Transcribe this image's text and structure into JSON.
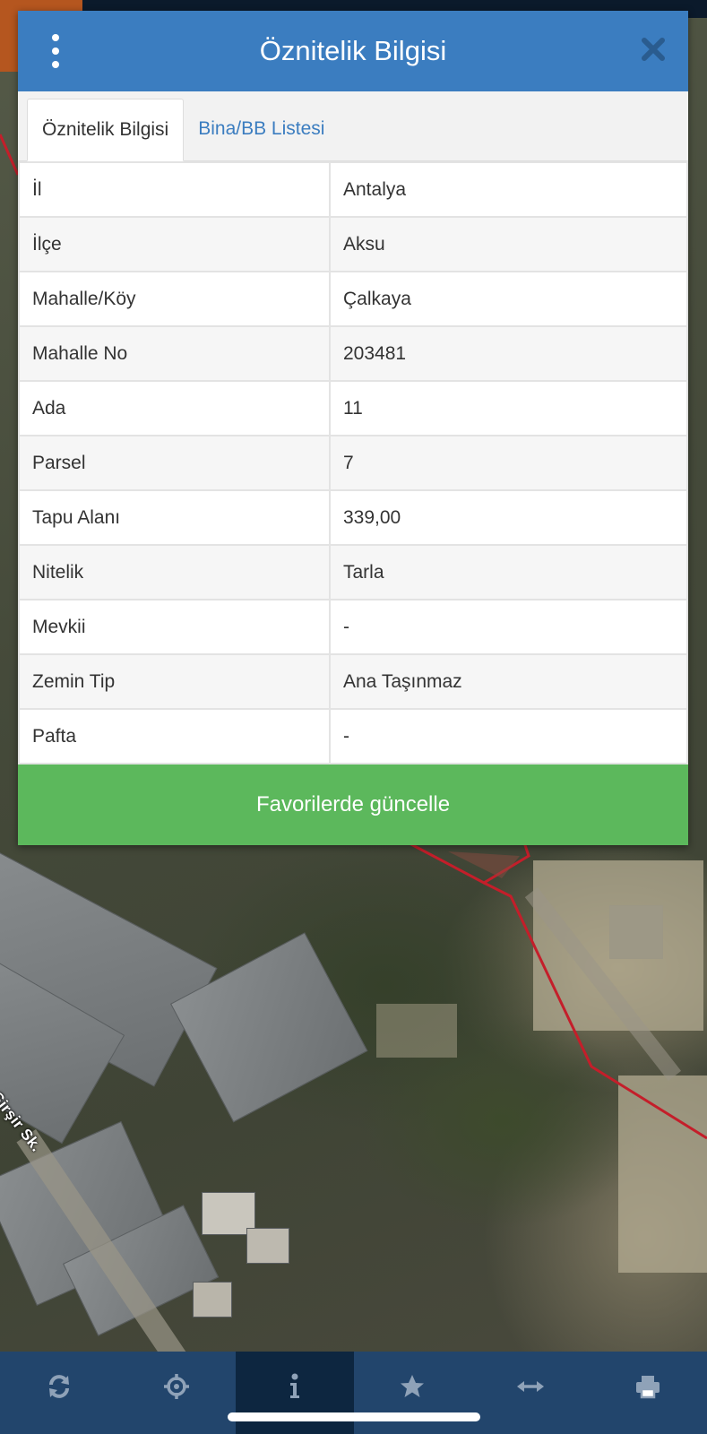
{
  "panel": {
    "title": "Öznitelik Bilgisi",
    "tabs": [
      {
        "label": "Öznitelik Bilgisi",
        "active": true
      },
      {
        "label": "Bina/BB Listesi",
        "active": false
      }
    ],
    "rows": [
      {
        "key": "İl",
        "value": "Antalya"
      },
      {
        "key": "İlçe",
        "value": "Aksu"
      },
      {
        "key": "Mahalle/Köy",
        "value": "Çalkaya"
      },
      {
        "key": "Mahalle No",
        "value": "203481"
      },
      {
        "key": "Ada",
        "value": "11"
      },
      {
        "key": "Parsel",
        "value": "7"
      },
      {
        "key": "Tapu Alanı",
        "value": "339,00"
      },
      {
        "key": "Nitelik",
        "value": "Tarla"
      },
      {
        "key": "Mevkii",
        "value": "-"
      },
      {
        "key": "Zemin Tip",
        "value": "Ana Taşınmaz"
      },
      {
        "key": "Pafta",
        "value": "-"
      }
    ],
    "favorite_button_label": "Favorilerde güncelle"
  },
  "map": {
    "street_label": "Şirşir Sk.",
    "parcel_line_color": "#c41e2a"
  },
  "toolbar": {
    "items": [
      {
        "icon": "refresh-icon",
        "active": false
      },
      {
        "icon": "locate-icon",
        "active": false
      },
      {
        "icon": "info-icon",
        "active": true
      },
      {
        "icon": "star-icon",
        "active": false
      },
      {
        "icon": "measure-icon",
        "active": false
      },
      {
        "icon": "print-icon",
        "active": false
      }
    ]
  },
  "colors": {
    "header": "#3b7dc0",
    "button": "#5cb85c",
    "toolbar": "#22456c",
    "toolbar_active": "#0d2640",
    "toolbar_icon": "#8fa2b8"
  }
}
